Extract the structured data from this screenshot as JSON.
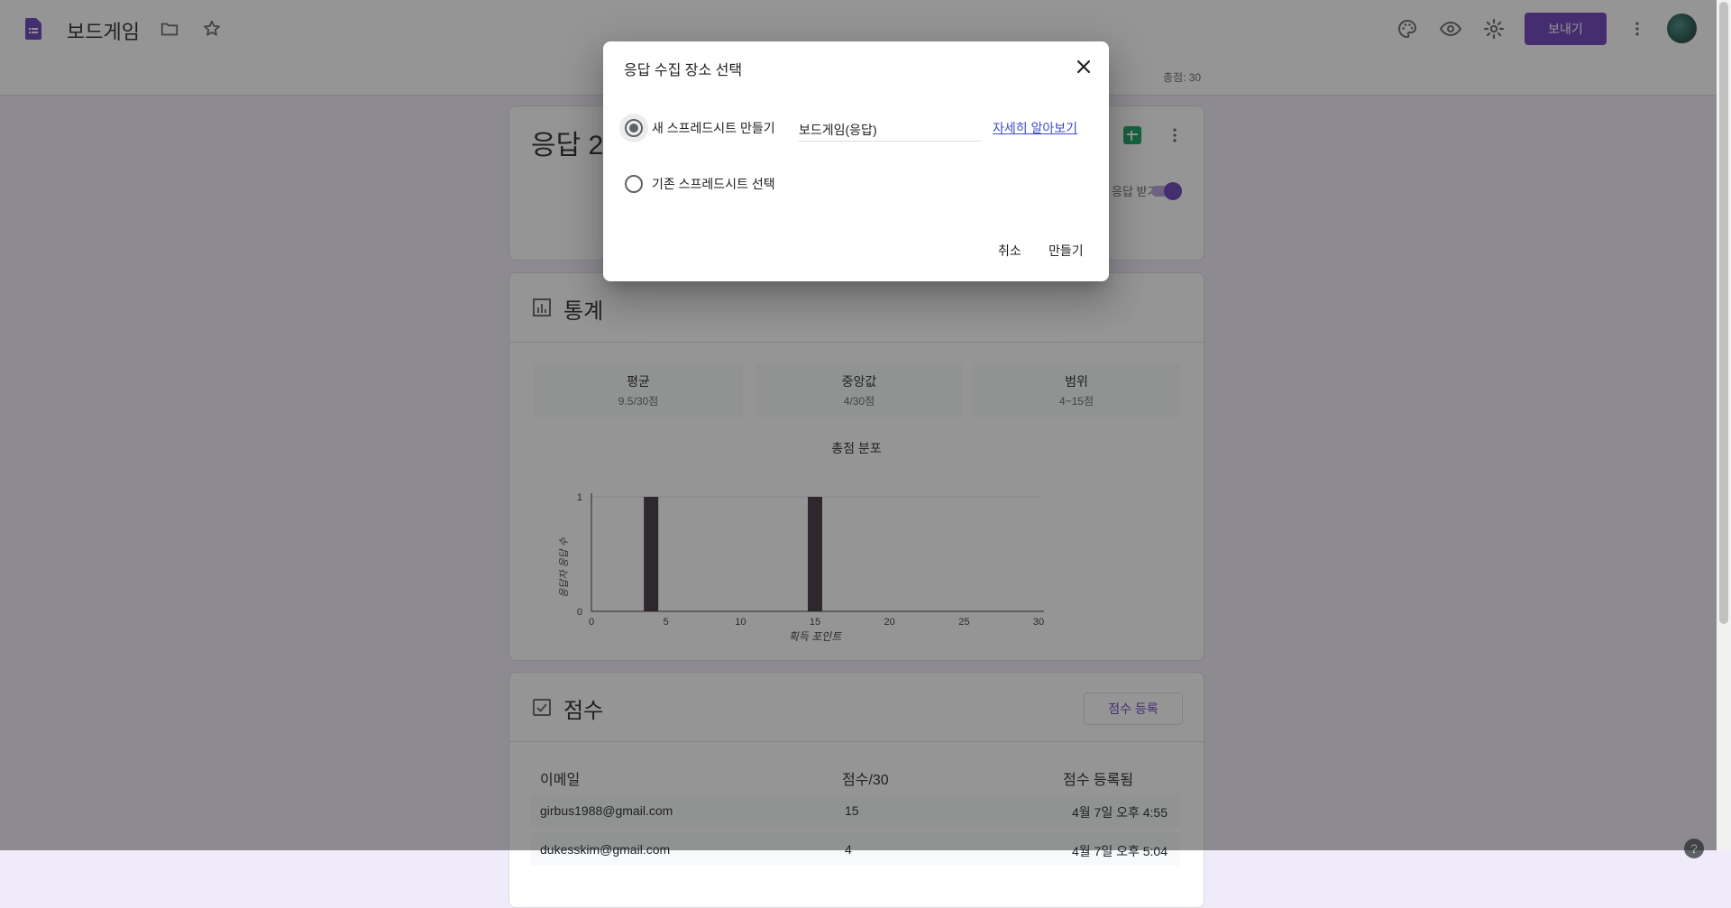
{
  "header": {
    "doc_title": "보드게임",
    "send_label": "보내기",
    "total_score_label": "총점: 30"
  },
  "summary_card": {
    "title": "응답 2",
    "accepting_label": "응답 받기"
  },
  "stats": {
    "title": "통계",
    "boxes": [
      {
        "label": "평균",
        "value": "9.5/30점"
      },
      {
        "label": "중앙값",
        "value": "4/30점"
      },
      {
        "label": "범위",
        "value": "4~15점"
      }
    ],
    "chart_title": "총점 분포"
  },
  "chart_data": {
    "type": "bar",
    "title": "총점 분포",
    "xlabel": "획득 포인트",
    "ylabel": "응답자 응답 수",
    "x": [
      4,
      15
    ],
    "values": [
      1,
      1
    ],
    "xlim": [
      0,
      30
    ],
    "ylim": [
      0,
      1
    ],
    "xticks": [
      "0",
      "5",
      "10",
      "15",
      "20",
      "25",
      "30"
    ],
    "yticks": [
      "0",
      "1"
    ],
    "bar_color": "#3c2d3b"
  },
  "scores": {
    "title": "점수",
    "register_button": "점수 등록",
    "columns": [
      "이메일",
      "점수/30",
      "점수 등록됨"
    ],
    "rows": [
      {
        "email": "girbus1988@gmail.com",
        "score": "15",
        "date": "4월 7일 오후 4:55"
      },
      {
        "email": "dukesskim@gmail.com",
        "score": "4",
        "date": "4월 7일 오후 5:04"
      }
    ]
  },
  "dialog": {
    "title": "응답 수집 장소 선택",
    "option_new": "새 스프레드시트 만들기",
    "new_sheet_name": "보드게임(응답)",
    "learn_more": "자세히 알아보기",
    "option_existing": "기존 스프레드시트 선택",
    "cancel": "취소",
    "create": "만들기"
  },
  "help_label": "?"
}
